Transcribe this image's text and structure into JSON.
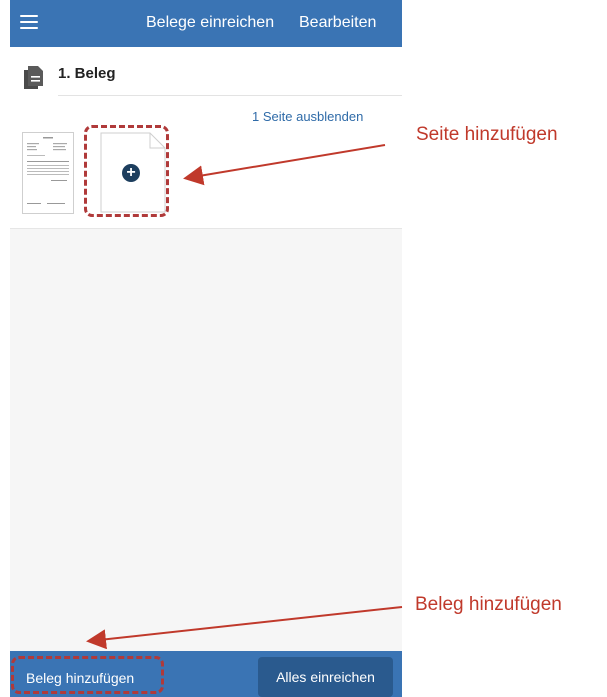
{
  "header": {
    "title": "Belege einreichen",
    "edit_label": "Bearbeiten",
    "color": "#3a74b4"
  },
  "beleg": {
    "title": "1. Beleg",
    "toggle_pages": "1 Seite ausblenden"
  },
  "bottom": {
    "add_label": "Beleg hinzufügen",
    "submit_label": "Alles einreichen"
  },
  "annotations": {
    "add_page": "Seite hinzufügen",
    "add_beleg": "Beleg hinzufügen",
    "color": "#c0392b"
  },
  "icons": {
    "menu": "hamburger-icon",
    "document": "document-icon",
    "add": "plus-circle-icon"
  }
}
